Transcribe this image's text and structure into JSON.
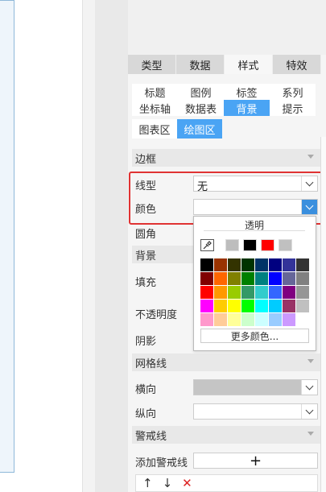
{
  "main_tabs": [
    "类型",
    "数据",
    "样式",
    "特效"
  ],
  "active_main_tab": "样式",
  "sub_tabs": [
    "标题",
    "图例",
    "标签",
    "系列",
    "坐标轴",
    "数据表",
    "背景",
    "提示"
  ],
  "area_tabs": [
    "图表区",
    "绘图区"
  ],
  "sections": {
    "border": "边框",
    "background": "背景",
    "gridlines": "网格线",
    "warning": "警戒线"
  },
  "labels": {
    "line_type": "线型",
    "color": "颜色",
    "rounded": "圆角",
    "fill": "填充",
    "opacity": "不透明度",
    "shadow": "阴影",
    "horizontal": "横向",
    "vertical": "纵向",
    "add_warning": "添加警戒线"
  },
  "line_type_value": "无",
  "picker": {
    "transparent": "透明",
    "more_colors": "更多颜色...",
    "recent": [
      "#bdbdbd",
      "#000000",
      "#ff0000",
      "#c0c0c0"
    ],
    "palette": [
      "#000000",
      "#993300",
      "#333300",
      "#003300",
      "#003366",
      "#000080",
      "#333399",
      "#333333",
      "#800000",
      "#ff6600",
      "#808000",
      "#008000",
      "#008080",
      "#0000ff",
      "#666699",
      "#808080",
      "#ff0000",
      "#ff9900",
      "#99cc00",
      "#339966",
      "#33cccc",
      "#3366ff",
      "#800080",
      "#969696",
      "#ff00ff",
      "#ffcc00",
      "#ffff00",
      "#00ff00",
      "#00ffff",
      "#00ccff",
      "#993366",
      "#c0c0c0",
      "#ff99cc",
      "#ffcc99",
      "#ffff99",
      "#ccffcc",
      "#ccffff",
      "#99ccff",
      "#cc99ff",
      "#ffffff"
    ]
  },
  "icons": {
    "plus": "+",
    "up": "↑",
    "down": "↓",
    "delete": "✕"
  }
}
